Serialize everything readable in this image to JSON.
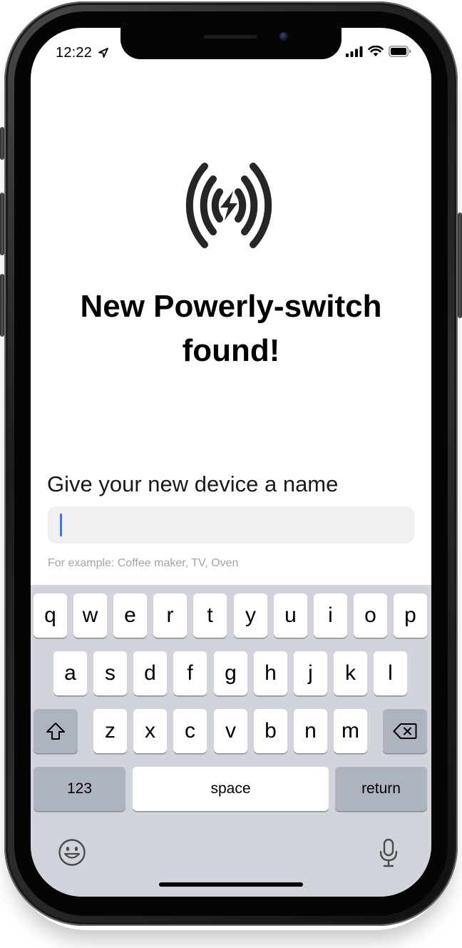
{
  "status_bar": {
    "time": "12:22",
    "icons": [
      "location-arrow-icon",
      "signal-bars-icon",
      "wifi-icon",
      "battery-icon"
    ]
  },
  "hero": {
    "icon": "wireless-power-icon",
    "title_line1": "New Powerly-switch",
    "title_line2": "found!"
  },
  "form": {
    "label": "Give your new device a name",
    "input_value": "",
    "hint": "For example: Coffee maker, TV, Oven"
  },
  "keyboard": {
    "row1": [
      "q",
      "w",
      "e",
      "r",
      "t",
      "y",
      "u",
      "i",
      "o",
      "p"
    ],
    "row2": [
      "a",
      "s",
      "d",
      "f",
      "g",
      "h",
      "j",
      "k",
      "l"
    ],
    "row3": [
      "z",
      "x",
      "c",
      "v",
      "b",
      "n",
      "m"
    ],
    "shift_icon": "shift-arrow-icon",
    "delete_icon": "backspace-icon",
    "numbers_label": "123",
    "space_label": "space",
    "return_label": "return",
    "emoji_icon": "emoji-icon",
    "dictation_icon": "microphone-icon"
  },
  "colors": {
    "caret": "#3478f6",
    "keyboard_bg": "#d1d4da",
    "key_dark": "#aeb4be",
    "field_bg": "#f0f0f2"
  }
}
